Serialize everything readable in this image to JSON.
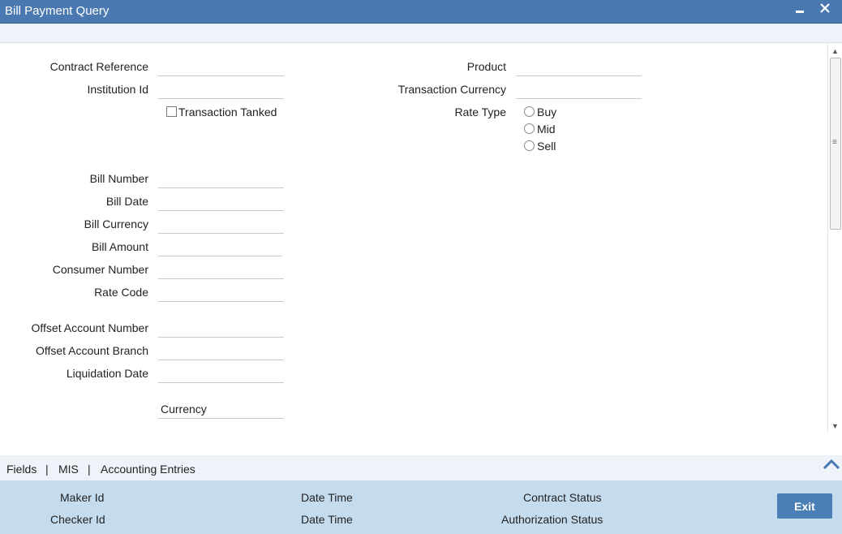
{
  "window": {
    "title": "Bill Payment Query",
    "minimize_glyph": "▄",
    "close_glyph": "✕"
  },
  "form": {
    "contract_reference": {
      "label": "Contract Reference",
      "value": ""
    },
    "institution_id": {
      "label": "Institution Id",
      "value": ""
    },
    "transaction_tanked": {
      "label": "Transaction Tanked",
      "checked": false
    },
    "product": {
      "label": "Product",
      "value": ""
    },
    "transaction_currency": {
      "label": "Transaction Currency",
      "value": ""
    },
    "rate_type": {
      "label": "Rate Type",
      "options": [
        "Buy",
        "Mid",
        "Sell"
      ],
      "selected": ""
    },
    "bill_number": {
      "label": "Bill Number",
      "value": ""
    },
    "bill_date": {
      "label": "Bill Date",
      "value": ""
    },
    "bill_currency": {
      "label": "Bill Currency",
      "value": ""
    },
    "bill_amount": {
      "label": "Bill Amount",
      "value": ""
    },
    "consumer_number": {
      "label": "Consumer Number",
      "value": ""
    },
    "rate_code": {
      "label": "Rate Code",
      "value": ""
    },
    "offset_account_number": {
      "label": "Offset Account Number",
      "value": ""
    },
    "offset_account_branch": {
      "label": "Offset Account Branch",
      "value": ""
    },
    "liquidation_date": {
      "label": "Liquidation Date",
      "value": ""
    },
    "currency": {
      "label": "Currency",
      "value": ""
    }
  },
  "tabs": {
    "fields": "Fields",
    "mis": "MIS",
    "accounting_entries": "Accounting Entries",
    "separator": "|"
  },
  "footer": {
    "maker_id": "Maker Id",
    "checker_id": "Checker Id",
    "maker_date_time": "Date Time",
    "checker_date_time": "Date Time",
    "contract_status": "Contract Status",
    "authorization_status": "Authorization Status",
    "exit": "Exit"
  },
  "icons": {
    "minimize": "minimize-icon",
    "close": "close-icon",
    "collapse": "chevron-up-icon",
    "scroll_up": "scroll-up-icon",
    "scroll_down": "scroll-down-icon"
  },
  "colors": {
    "titlebar": "#4a78b0",
    "footer": "#c5dcef",
    "strip": "#eef3fa",
    "exit_button": "#4a7fb5"
  }
}
